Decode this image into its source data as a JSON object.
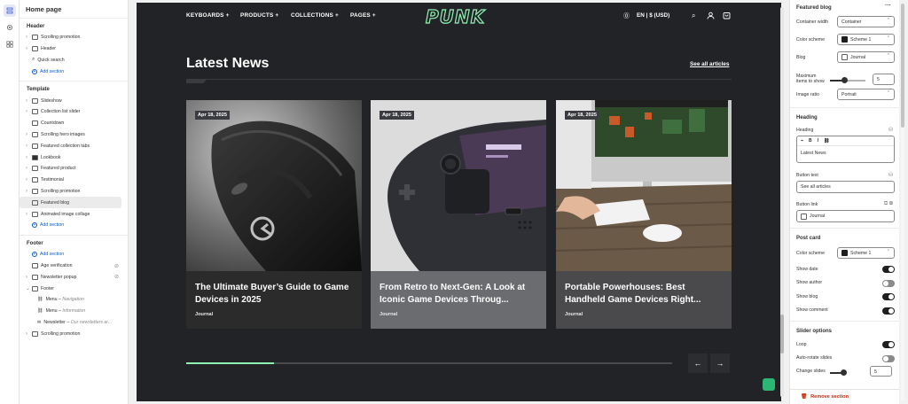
{
  "rail": {
    "icons": [
      "sections-icon",
      "settings-icon",
      "apps-icon"
    ]
  },
  "left": {
    "title": "Home page",
    "header_group": {
      "label": "Header",
      "items": [
        {
          "label": "Scrolling promotion",
          "icon": "section-icon"
        },
        {
          "label": "Header",
          "icon": "section-icon"
        },
        {
          "label": "Quick search",
          "icon": "search-icon"
        }
      ],
      "add": "Add section"
    },
    "template_group": {
      "label": "Template",
      "items": [
        {
          "label": "Slideshow"
        },
        {
          "label": "Collection list slider"
        },
        {
          "label": "Countdown"
        },
        {
          "label": "Scrolling hero images"
        },
        {
          "label": "Featured collection tabs"
        },
        {
          "label": "Lookbook"
        },
        {
          "label": "Featured product"
        },
        {
          "label": "Testimonial"
        },
        {
          "label": "Scrolling promotion"
        },
        {
          "label": "Featured blog"
        },
        {
          "label": "Animated image collage"
        }
      ],
      "add": "Add section"
    },
    "footer_group": {
      "label": "Footer",
      "add": "Add section",
      "items": [
        {
          "label": "Age verification"
        },
        {
          "label": "Newsletter popup"
        },
        {
          "label": "Footer"
        }
      ],
      "sub": [
        {
          "label": "Menu",
          "detail": "Navigation"
        },
        {
          "label": "Menu",
          "detail": "Information"
        },
        {
          "label": "Newsletter",
          "detail": "Our newsletters ar..."
        }
      ],
      "last": "Scrolling promotion"
    }
  },
  "store": {
    "nav": [
      "KEYBOARDS +",
      "PRODUCTS +",
      "COLLECTIONS +",
      "PAGES +"
    ],
    "logo": "PUNK",
    "locale": "EN | $ (USD)",
    "heading": "Latest News",
    "see_all": "See all articles",
    "accent": "#8ef0b1",
    "progress": 0.18,
    "cards": [
      {
        "date": "Apr 18, 2025",
        "title": "The Ultimate Buyer’s Guide to Game Devices in 2025",
        "tag": "Journal"
      },
      {
        "date": "Apr 18, 2025",
        "title": "From Retro to Next-Gen: A Look at Iconic Game Devices Throug...",
        "tag": "Journal"
      },
      {
        "date": "Apr 18, 2025",
        "title": "Portable Powerhouses: Best Handheld Game Devices Right...",
        "tag": "Journal"
      }
    ]
  },
  "right": {
    "title": "Featured blog",
    "container_width": {
      "label": "Container width",
      "value": "Container"
    },
    "color_scheme": {
      "label": "Color scheme",
      "value": "Scheme 1"
    },
    "blog": {
      "label": "Blog",
      "value": "Journal"
    },
    "max_items": {
      "label": "Maximum items to show",
      "value": "5",
      "fraction": 0.4
    },
    "image_ratio": {
      "label": "Image ratio",
      "value": "Portrait"
    },
    "heading_section": "Heading",
    "heading_label": "Heading",
    "heading_value": "Latest News",
    "button_text_label": "Button text",
    "button_text_value": "See all articles",
    "button_link_label": "Button link",
    "button_link_value": "Journal",
    "post_card": "Post card",
    "post_scheme": {
      "label": "Color scheme",
      "value": "Scheme 1"
    },
    "toggles": [
      {
        "label": "Show date",
        "on": true
      },
      {
        "label": "Show author",
        "on": false
      },
      {
        "label": "Show blog",
        "on": true
      },
      {
        "label": "Show comment",
        "on": true
      }
    ],
    "slider_options": "Slider options",
    "slider_toggles": [
      {
        "label": "Loop",
        "on": true
      },
      {
        "label": "Auto-rotate slides",
        "on": false
      }
    ],
    "change_slides": {
      "label": "Change slides",
      "value": "5"
    },
    "remove": "Remove section"
  }
}
